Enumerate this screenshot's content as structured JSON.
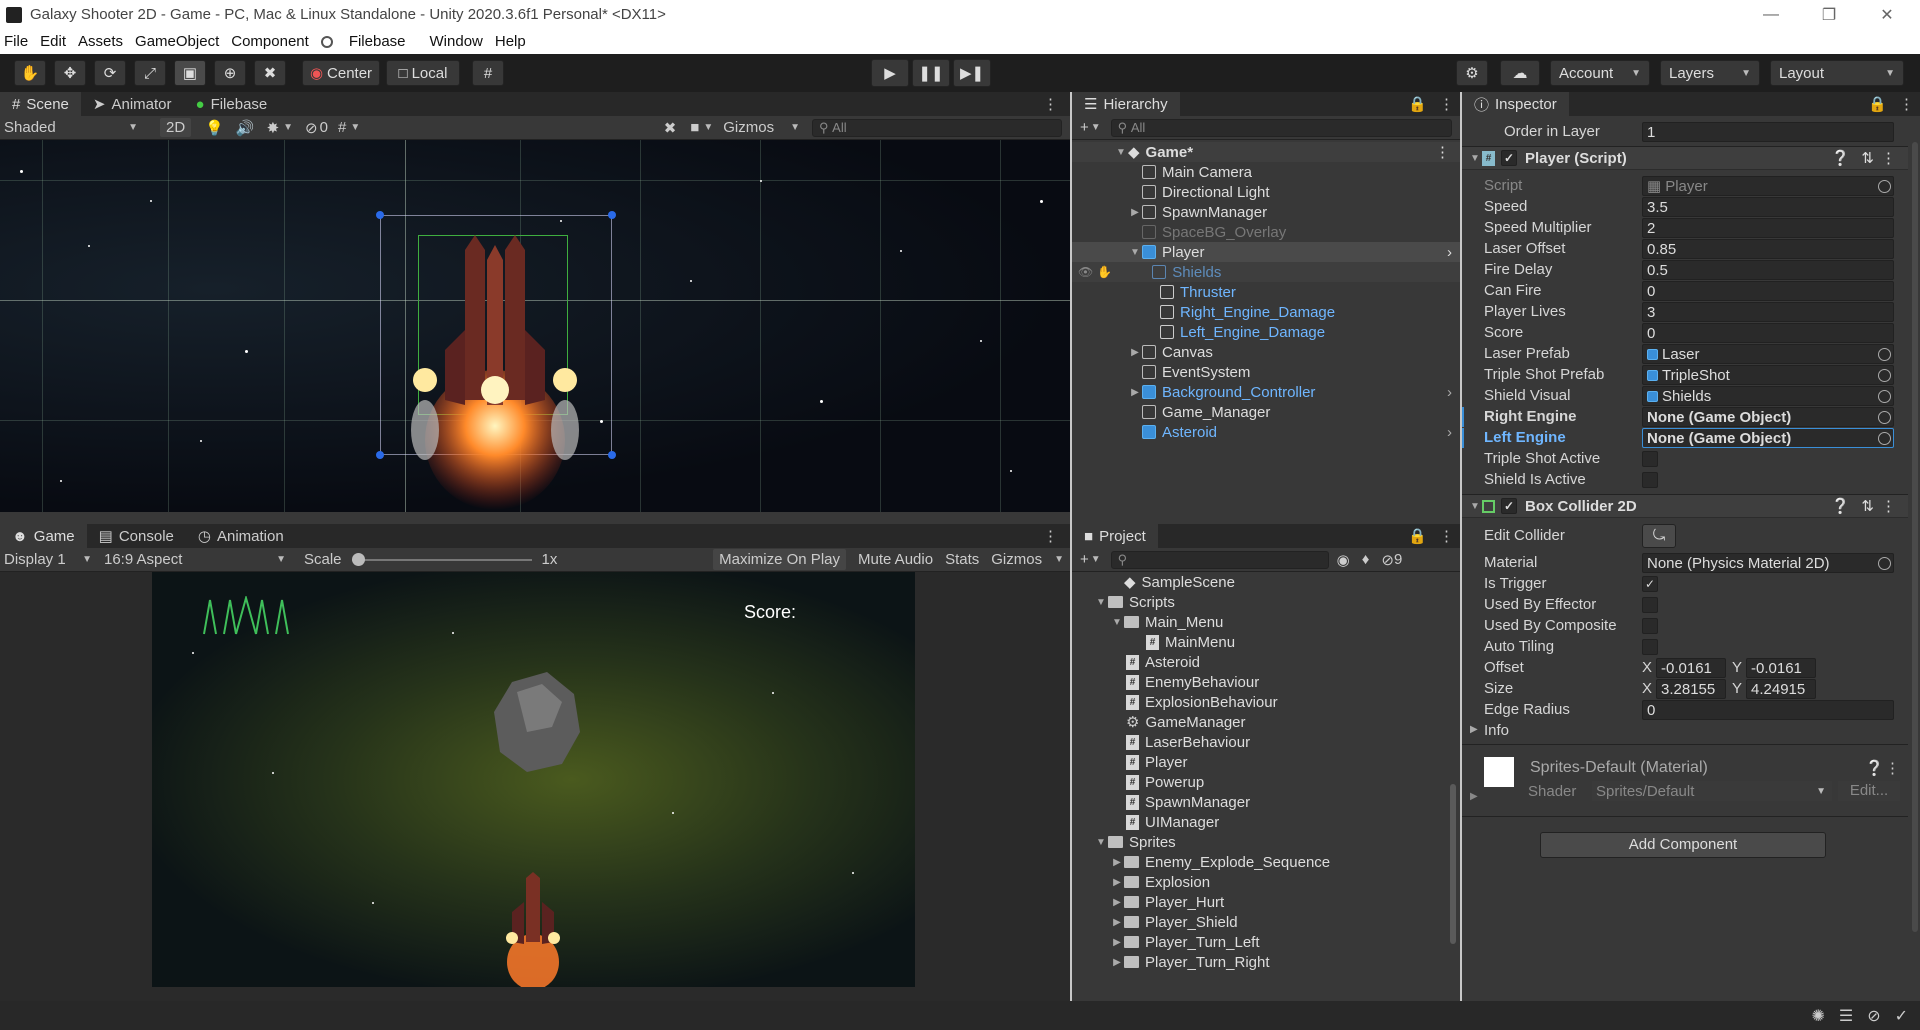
{
  "window": {
    "title": "Galaxy Shooter 2D - Game - PC, Mac & Linux Standalone - Unity 2020.3.6f1 Personal* <DX11>"
  },
  "menu": [
    "File",
    "Edit",
    "Assets",
    "GameObject",
    "Component",
    "Filebase",
    "Window",
    "Help"
  ],
  "toolbar": {
    "center": "Center",
    "local": "Local",
    "account": "Account",
    "layers": "Layers",
    "layout": "Layout"
  },
  "scene": {
    "tabs": [
      "Scene",
      "Animator",
      "Filebase"
    ],
    "shading": "Shaded",
    "mode_2d": "2D",
    "hidden_count": "0",
    "gizmos": "Gizmos",
    "search_placeholder": "All"
  },
  "game": {
    "tabs": [
      "Game",
      "Console",
      "Animation"
    ],
    "display": "Display 1",
    "aspect": "16:9 Aspect",
    "scale_label": "Scale",
    "scale_value": "1x",
    "maximize": "Maximize On Play",
    "mute": "Mute Audio",
    "stats": "Stats",
    "gizmos": "Gizmos",
    "score_label": "Score:"
  },
  "hierarchy": {
    "tab": "Hierarchy",
    "search_placeholder": "All",
    "items": [
      {
        "label": "Game*"
      },
      {
        "label": "Main Camera"
      },
      {
        "label": "Directional Light"
      },
      {
        "label": "SpawnManager"
      },
      {
        "label": "SpaceBG_Overlay"
      },
      {
        "label": "Player"
      },
      {
        "label": "Shields"
      },
      {
        "label": "Thruster"
      },
      {
        "label": "Right_Engine_Damage"
      },
      {
        "label": "Left_Engine_Damage"
      },
      {
        "label": "Canvas"
      },
      {
        "label": "EventSystem"
      },
      {
        "label": "Background_Controller"
      },
      {
        "label": "Game_Manager"
      },
      {
        "label": "Asteroid"
      }
    ]
  },
  "project": {
    "tab": "Project",
    "hidden_count": "9",
    "items": [
      {
        "label": "SampleScene"
      },
      {
        "label": "Scripts"
      },
      {
        "label": "Main_Menu"
      },
      {
        "label": "MainMenu"
      },
      {
        "label": "Asteroid"
      },
      {
        "label": "EnemyBehaviour"
      },
      {
        "label": "ExplosionBehaviour"
      },
      {
        "label": "GameManager"
      },
      {
        "label": "LaserBehaviour"
      },
      {
        "label": "Player"
      },
      {
        "label": "Powerup"
      },
      {
        "label": "SpawnManager"
      },
      {
        "label": "UIManager"
      },
      {
        "label": "Sprites"
      },
      {
        "label": "Enemy_Explode_Sequence"
      },
      {
        "label": "Explosion"
      },
      {
        "label": "Player_Hurt"
      },
      {
        "label": "Player_Shield"
      },
      {
        "label": "Player_Turn_Left"
      },
      {
        "label": "Player_Turn_Right"
      }
    ]
  },
  "inspector": {
    "tab": "Inspector",
    "order_in_layer": {
      "label": "Order in Layer",
      "value": "1"
    },
    "player_script": {
      "title": "Player (Script)",
      "fields": [
        {
          "label": "Script",
          "value": "Player"
        },
        {
          "label": "Speed",
          "value": "3.5"
        },
        {
          "label": "Speed Multiplier",
          "value": "2"
        },
        {
          "label": "Laser Offset",
          "value": "0.85"
        },
        {
          "label": "Fire Delay",
          "value": "0.5"
        },
        {
          "label": "Can Fire",
          "value": "0"
        },
        {
          "label": "Player Lives",
          "value": "3"
        },
        {
          "label": "Score",
          "value": "0"
        },
        {
          "label": "Laser Prefab",
          "value": "Laser"
        },
        {
          "label": "Triple Shot Prefab",
          "value": "TripleShot"
        },
        {
          "label": "Shield Visual",
          "value": "Shields"
        },
        {
          "label": "Right Engine",
          "value": "None (Game Object)"
        },
        {
          "label": "Left Engine",
          "value": "None (Game Object)"
        },
        {
          "label": "Triple Shot Active",
          "value": ""
        },
        {
          "label": "Shield Is Active",
          "value": ""
        }
      ]
    },
    "box_collider": {
      "title": "Box Collider 2D",
      "edit_collider": "Edit Collider",
      "material": {
        "label": "Material",
        "value": "None (Physics Material 2D)"
      },
      "is_trigger": "Is Trigger",
      "used_by_effector": "Used By Effector",
      "used_by_composite": "Used By Composite",
      "auto_tiling": "Auto Tiling",
      "offset": {
        "label": "Offset",
        "x": "-0.0161",
        "y": "-0.0161"
      },
      "size": {
        "label": "Size",
        "x": "3.28155",
        "y": "4.24915"
      },
      "edge_radius": {
        "label": "Edge Radius",
        "value": "0"
      },
      "info": "Info",
      "x_label": "X",
      "y_label": "Y"
    },
    "material": {
      "title": "Sprites-Default (Material)",
      "shader_label": "Shader",
      "shader_value": "Sprites/Default",
      "edit": "Edit..."
    },
    "add_component": "Add Component"
  }
}
